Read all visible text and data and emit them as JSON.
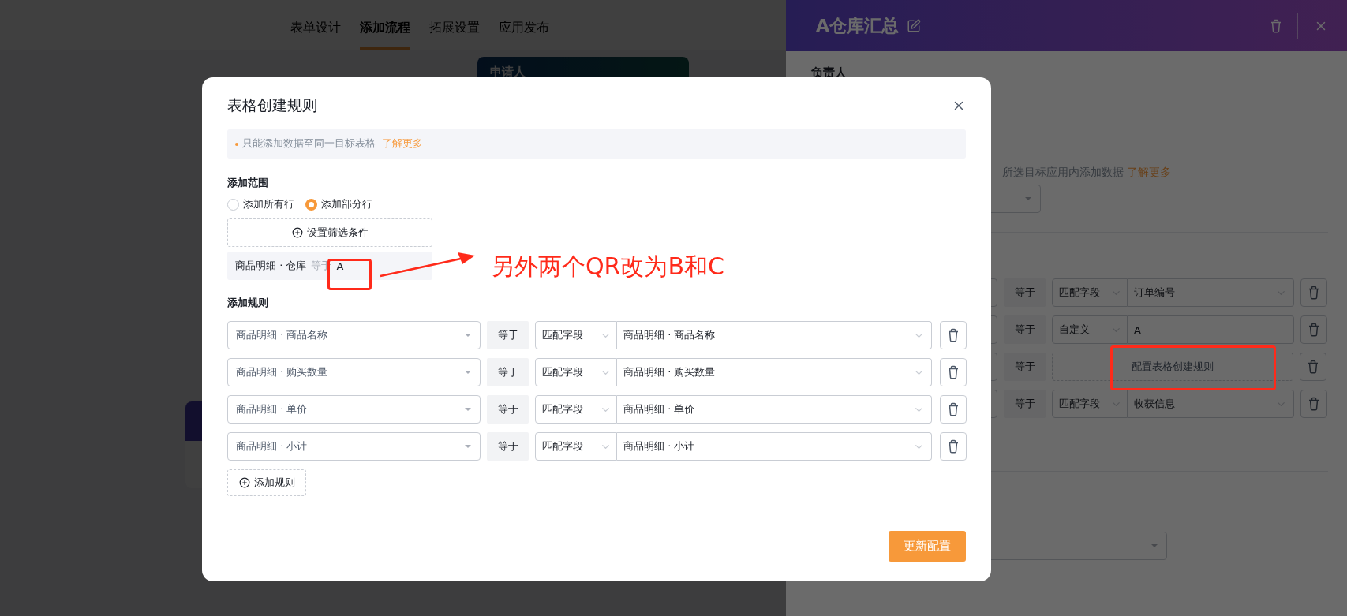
{
  "app_tabs": [
    {
      "label": "表单设计",
      "selected": false
    },
    {
      "label": "添加流程",
      "selected": true
    },
    {
      "label": "拓展设置",
      "selected": false
    },
    {
      "label": "应用发布",
      "selected": false
    }
  ],
  "flow_card": {
    "title": "申请人"
  },
  "drawer": {
    "title": "A仓库汇总",
    "section_label": "负责人",
    "hint": "所选目标应用内添加数据",
    "hint_link": "了解更多",
    "rules": [
      {
        "kind": "select",
        "operator": "等于",
        "mode": "匹配字段",
        "value": "订单编号"
      },
      {
        "kind": "input",
        "operator": "等于",
        "mode": "自定义",
        "value": "A"
      },
      {
        "kind": "configure",
        "operator": "等于",
        "value": "配置表格创建规则"
      },
      {
        "kind": "select",
        "operator": "等于",
        "mode": "匹配字段",
        "value": "收获信息"
      }
    ]
  },
  "modal": {
    "title": "表格创建规则",
    "notice": "只能添加数据至同一目标表格",
    "notice_link": "了解更多",
    "scope_label": "添加范围",
    "scope_options": [
      {
        "label": "添加所有行",
        "selected": false
      },
      {
        "label": "添加部分行",
        "selected": true
      }
    ],
    "filter_button": "设置筛选条件",
    "condition": {
      "field": "商品明细 · 仓库",
      "operator": "等于",
      "value": "A"
    },
    "rules_label": "添加规则",
    "rules": [
      {
        "field": "商品明细 · 商品名称",
        "operator": "等于",
        "mode": "匹配字段",
        "value": "商品明细 · 商品名称"
      },
      {
        "field": "商品明细 · 购买数量",
        "operator": "等于",
        "mode": "匹配字段",
        "value": "商品明细 · 购买数量"
      },
      {
        "field": "商品明细 · 单价",
        "operator": "等于",
        "mode": "匹配字段",
        "value": "商品明细 · 单价"
      },
      {
        "field": "商品明细 · 小计",
        "operator": "等于",
        "mode": "匹配字段",
        "value": "商品明细 · 小计"
      }
    ],
    "add_rule_button": "添加规则",
    "submit_button": "更新配置"
  },
  "annotation": {
    "text": "另外两个QR改为B和C"
  }
}
